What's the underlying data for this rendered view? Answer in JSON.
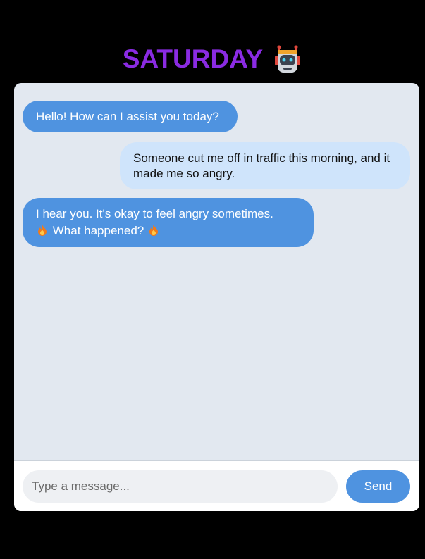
{
  "header": {
    "title": "SATURDAY",
    "icon": "robot-icon"
  },
  "messages": [
    {
      "sender": "bot",
      "text": "Hello! How can I assist you today?"
    },
    {
      "sender": "user",
      "text": "Someone cut me off in traffic this morning, and it made me so angry."
    },
    {
      "sender": "bot",
      "line1": "I hear you. It's okay to feel angry sometimes.",
      "line2": "What happened?",
      "icons": [
        "fire-icon",
        "fire-icon"
      ]
    }
  ],
  "composer": {
    "placeholder": "Type a message...",
    "send_label": "Send"
  },
  "colors": {
    "title": "#8a2be2",
    "bot_bubble": "#4f93e0",
    "user_bubble": "#cfe4fb",
    "chat_background": "#e2e8f0",
    "page_background": "#000000"
  }
}
